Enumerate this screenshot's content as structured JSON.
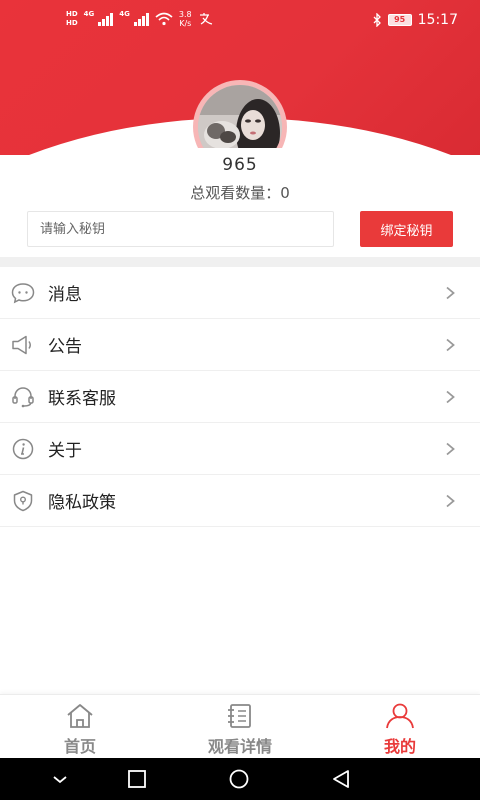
{
  "status_bar": {
    "hd_top": "HD",
    "hd_bottom": "HD",
    "net_type_1": "4G",
    "net_type_2": "4G",
    "speed_value": "3.8",
    "speed_unit": "K/s",
    "battery": "95",
    "time": "15:17"
  },
  "profile": {
    "username": "965",
    "views_text": "总观看数量：0"
  },
  "bind_key": {
    "placeholder": "请输入秘钥",
    "button_label": "绑定秘钥"
  },
  "menu": {
    "items": [
      {
        "label": "消息",
        "icon": "chat-bubble-icon"
      },
      {
        "label": "公告",
        "icon": "megaphone-icon"
      },
      {
        "label": "联系客服",
        "icon": "headset-icon"
      },
      {
        "label": "关于",
        "icon": "info-icon"
      },
      {
        "label": "隐私政策",
        "icon": "shield-icon"
      }
    ]
  },
  "tabs": [
    {
      "label": "首页",
      "icon": "home-icon",
      "active": false
    },
    {
      "label": "观看详情",
      "icon": "notebook-icon",
      "active": false
    },
    {
      "label": "我的",
      "icon": "user-icon",
      "active": true
    }
  ],
  "colors": {
    "accent": "#e93a3a",
    "header_red": "#e4323a"
  }
}
